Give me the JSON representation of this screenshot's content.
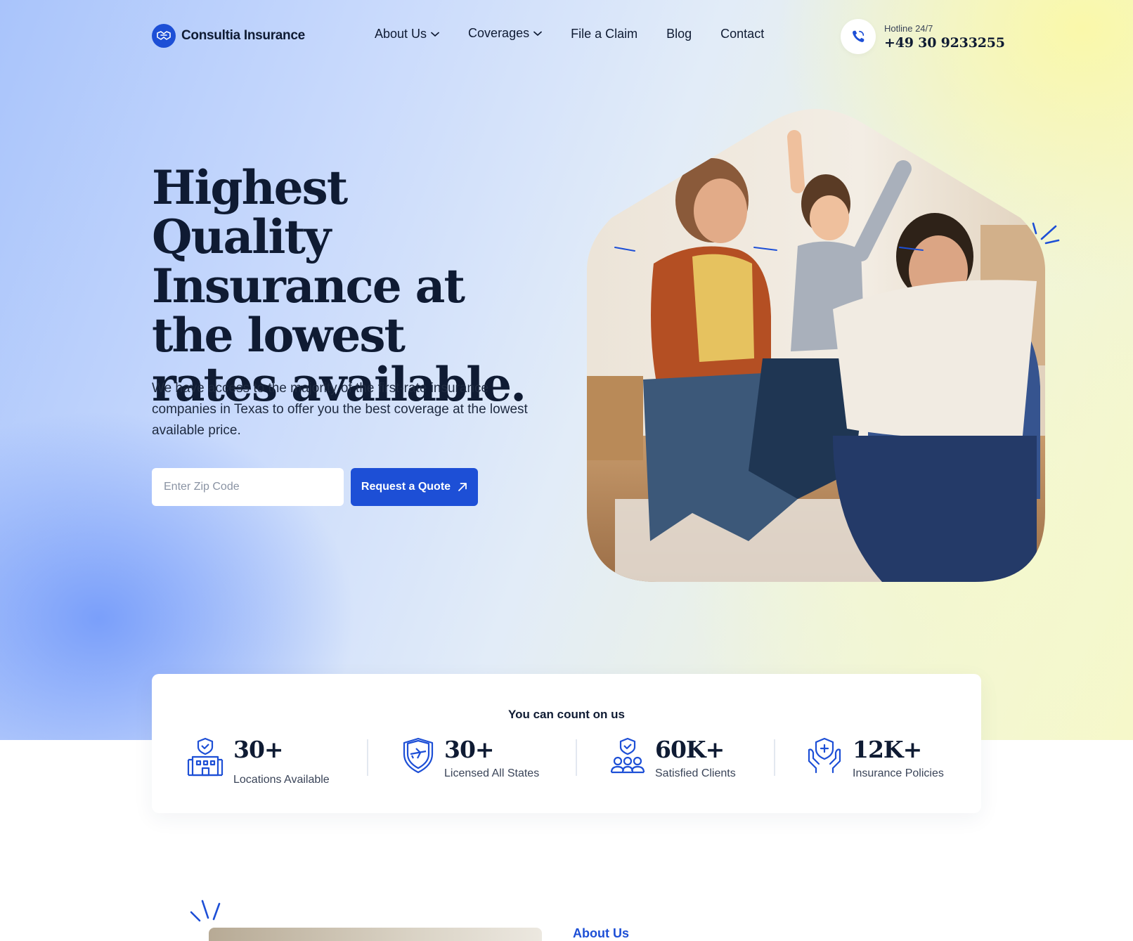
{
  "brand": {
    "name": "Consultia Insurance",
    "accent": "#1d4fd6",
    "text_color": "#0f1b33"
  },
  "nav": {
    "items": [
      {
        "label": "About Us",
        "dropdown": true
      },
      {
        "label": "Coverages",
        "dropdown": true
      },
      {
        "label": "File a Claim",
        "dropdown": false
      },
      {
        "label": "Blog",
        "dropdown": false
      },
      {
        "label": "Contact",
        "dropdown": false
      }
    ]
  },
  "hotline": {
    "label": "Hotline 24/7",
    "number": "+49 30 9233255",
    "icon": "phone-icon"
  },
  "hero": {
    "title": "Highest Quality Insurance at the lowest rates available.",
    "subtitle": "We have access to the majority of the first-rate insurance companies in Texas to offer you the best coverage at the lowest available price.",
    "zip_placeholder": "Enter Zip Code",
    "zip_value": "",
    "cta_label": "Request a Quote",
    "image_subject": "family-photo"
  },
  "stats": {
    "heading": "You can count on us",
    "items": [
      {
        "value": "30+",
        "label": "Locations Available",
        "icon": "building-icon"
      },
      {
        "value": "30+",
        "label": "Licensed All States",
        "icon": "shield-plane-icon"
      },
      {
        "value": "60K+",
        "label": "Satisfied Clients",
        "icon": "people-shield-icon"
      },
      {
        "value": "12K+",
        "label": "Insurance Policies",
        "icon": "hands-shield-icon"
      }
    ]
  },
  "about": {
    "label": "About Us"
  }
}
